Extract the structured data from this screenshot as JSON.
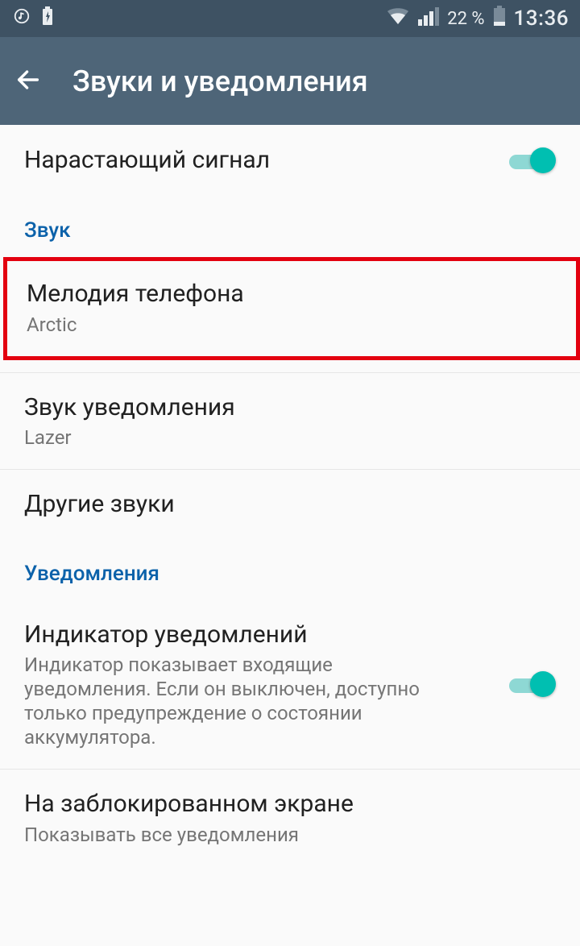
{
  "status": {
    "battery_percent": "22 %",
    "time": "13:36"
  },
  "header": {
    "title": "Звуки и уведомления"
  },
  "rows": {
    "rising": {
      "title": "Нарастающий сигнал"
    },
    "section_sound": "Звук",
    "ringtone": {
      "title": "Мелодия телефона",
      "sub": "Arctic"
    },
    "notif_sound": {
      "title": "Звук уведомления",
      "sub": "Lazer"
    },
    "other_sounds": {
      "title": "Другие звуки"
    },
    "section_notif": "Уведомления",
    "notif_led": {
      "title": "Индикатор уведомлений",
      "sub": "Индикатор показывает входящие уведомления. Если он выключен, доступно только предупреждение о состоянии аккумулятора."
    },
    "lock_screen": {
      "title": "На заблокированном экране",
      "sub": "Показывать все уведомления"
    }
  }
}
